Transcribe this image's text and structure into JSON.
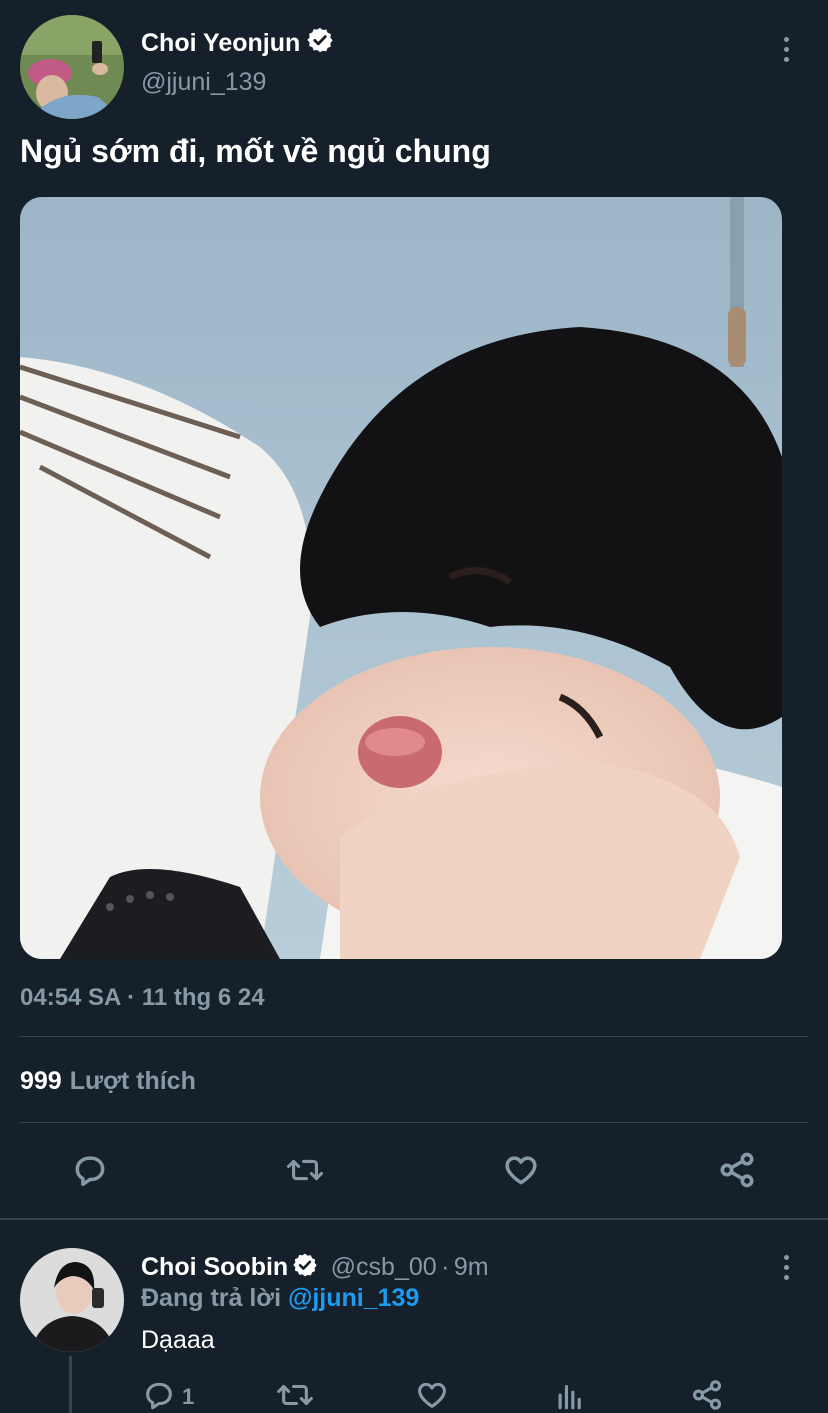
{
  "tweet": {
    "author_name": "Choi Yeonjun",
    "author_handle": "@jjuni_139",
    "text": "Ngủ sớm đi, mốt về ngủ chung",
    "timestamp": "04:54 SA · 11 thg 6 24",
    "likes_count": "999",
    "likes_label": "Lượt thích",
    "verified": true,
    "actions": [
      "reply-icon",
      "retweet-icon",
      "like-icon",
      "share-icon"
    ]
  },
  "reply": {
    "author_name": "Choi Soobin",
    "author_handle": "@csb_00",
    "time": "9m",
    "separator": "·",
    "replying_to_label": "Đang trả lời",
    "replying_to_handle": "@jjuni_139",
    "text": "Dạaaa",
    "reply_count": "1",
    "verified": true,
    "actions": [
      "reply-icon",
      "retweet-icon",
      "like-icon",
      "analytics-icon",
      "share-icon"
    ]
  },
  "colors": {
    "background": "#15202b",
    "secondary_text": "#8899a6",
    "accent": "#1d9bf0",
    "divider": "#38444d"
  }
}
